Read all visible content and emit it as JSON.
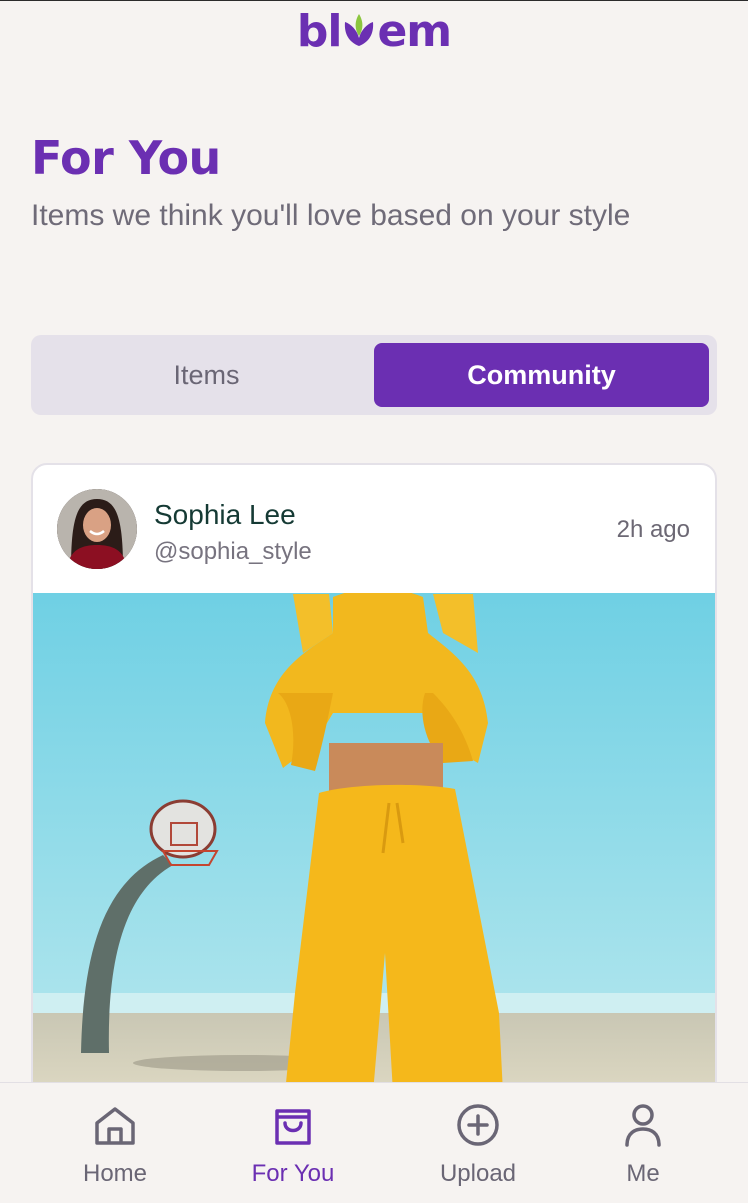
{
  "app": {
    "logo_text_left": "bl",
    "logo_text_right": "em",
    "brand_color": "#6b2fb2"
  },
  "page": {
    "title": "For You",
    "subtitle": "Items we think you'll love based on your style"
  },
  "tabs": {
    "items_label": "Items",
    "community_label": "Community",
    "selected": "Community"
  },
  "post": {
    "author_name": "Sophia Lee",
    "author_handle": "@sophia_style",
    "time": "2h ago"
  },
  "nav": {
    "home_label": "Home",
    "foryou_label": "For You",
    "upload_label": "Upload",
    "me_label": "Me",
    "active": "For You"
  },
  "icons": {
    "home": "home-icon",
    "foryou": "shopping-bag-icon",
    "upload": "plus-circle-icon",
    "me": "user-icon"
  }
}
